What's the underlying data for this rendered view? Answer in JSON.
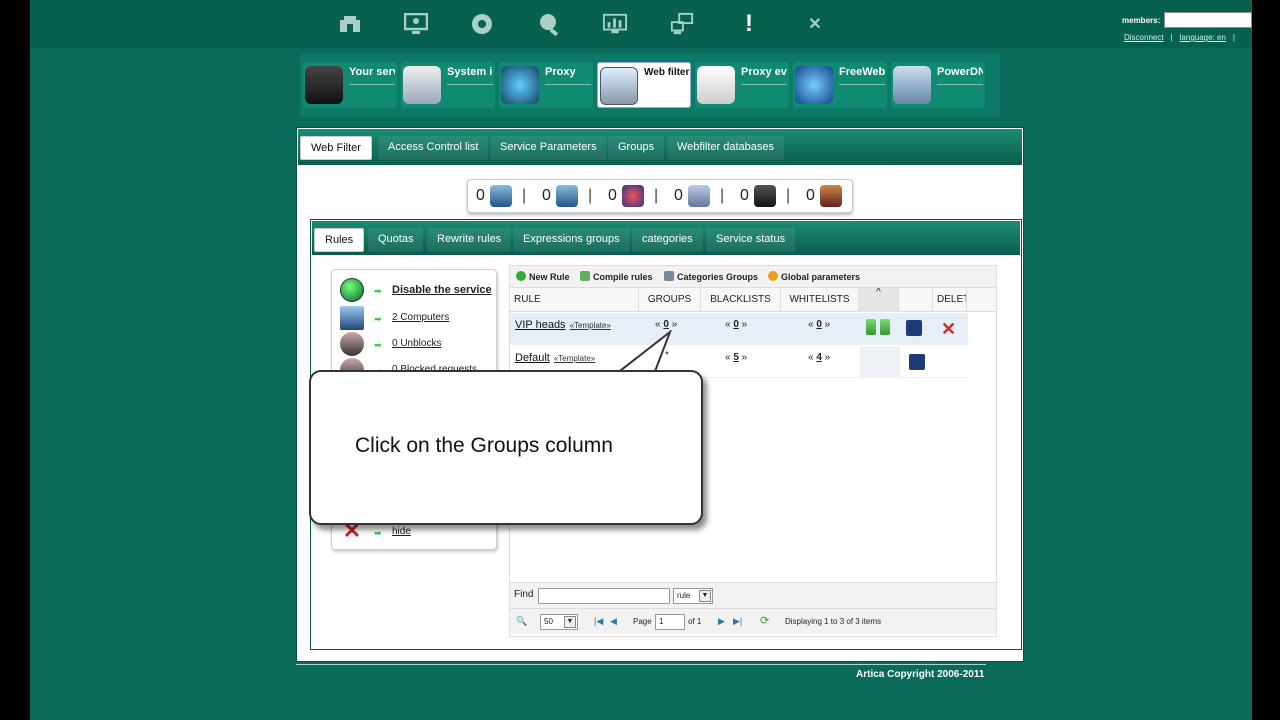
{
  "topbar": {
    "icons": [
      "home-icon",
      "monitor-icon",
      "gear-icon",
      "search-user-icon",
      "chart-icon",
      "network-icon",
      "alert-icon",
      "close-icon"
    ],
    "members_label": "members:",
    "disconnect": "Disconnect",
    "separator": "|",
    "language": "language: en"
  },
  "main_tabs": [
    {
      "label": "Your server",
      "icon": "server-icon",
      "active": false
    },
    {
      "label": "System information",
      "icon": "system-icon",
      "active": false
    },
    {
      "label": "Proxy",
      "icon": "proxy-icon",
      "active": false
    },
    {
      "label": "Web filtering",
      "icon": "webfilter-icon",
      "active": true
    },
    {
      "label": "Proxy events",
      "icon": "proxy-events-icon",
      "active": false
    },
    {
      "label": "FreeWebs",
      "icon": "freewebs-icon",
      "active": false
    },
    {
      "label": "PowerDNS",
      "icon": "powerdns-icon",
      "active": false
    }
  ],
  "panel_tabs": [
    "Web Filter",
    "Access Control list",
    "Service Parameters",
    "Groups",
    "Webfilter databases"
  ],
  "stats": [
    {
      "value": "0",
      "icon": "computer-blocked-icon"
    },
    {
      "value": "0",
      "icon": "computer-allowed-icon"
    },
    {
      "value": "0",
      "icon": "globe-shield-icon"
    },
    {
      "value": "0",
      "icon": "database-blocked-icon"
    },
    {
      "value": "0",
      "icon": "user-spy-icon"
    },
    {
      "value": "0",
      "icon": "trash-icon"
    }
  ],
  "inner_tabs": [
    "Rules",
    "Quotas",
    "Rewrite rules",
    "Expressions groups",
    "categories",
    "Service status"
  ],
  "sidebar": {
    "items": [
      {
        "label": "Disable the service",
        "icon": "green-orb-icon",
        "bold": true
      },
      {
        "label": "2 Computers",
        "icon": "computer-icon",
        "bold": false
      },
      {
        "label": "0 Unblocks",
        "icon": "users-icon",
        "bold": false
      },
      {
        "label": "0 Blocked requests",
        "icon": "user-blocked-icon",
        "bold": false
      }
    ],
    "hide_label": "hide"
  },
  "grid": {
    "toolbar": [
      "New Rule",
      "Compile rules",
      "Categories Groups",
      "Global parameters"
    ],
    "headers": [
      "RULE",
      "GROUPS",
      "BLACKLISTS",
      "WHITELISTS",
      "^",
      "",
      "DELETE"
    ],
    "rows": [
      {
        "name": "VIP heads",
        "template": "«Template»",
        "groups": "0",
        "blacklists": "0",
        "whitelists": "0"
      },
      {
        "name": "Default",
        "template": "«Template»",
        "groups": "*",
        "blacklists": "5",
        "whitelists": "4"
      }
    ],
    "find_label": "Find",
    "find_select": "rule",
    "per_page": "50",
    "page_label": "Page",
    "page_value": "1",
    "of_label": "of 1",
    "displaying": "Displaying 1 to 3 of 3 items"
  },
  "callout": {
    "text": "Click on the Groups column"
  },
  "footer": {
    "copyright": "Artica Copyright 2006-2011"
  }
}
